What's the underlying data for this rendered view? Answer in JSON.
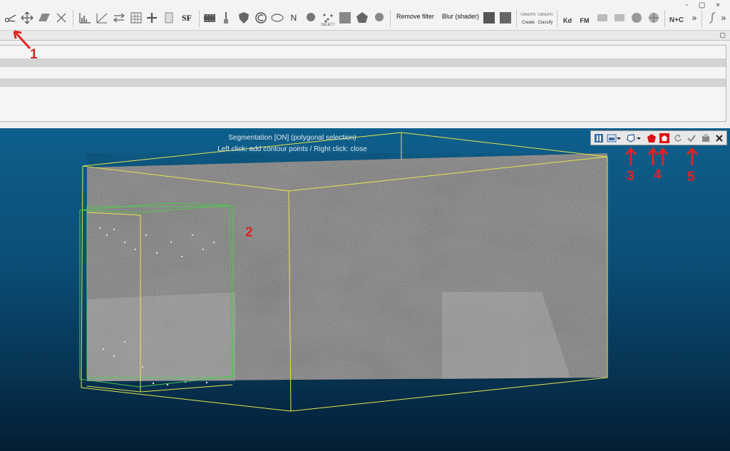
{
  "toolbar": {
    "sf_label": "SF",
    "n_label": "N",
    "select_caption": "SELECT",
    "remove_filter": "Remove filter",
    "blur_shader": "Blur (shader)",
    "canupo_caption1": "CANUPO",
    "create_caption": "Create",
    "canupo_caption2": "CANUPO",
    "classify_caption": "Classify",
    "kd_label": "Kd",
    "fm_label": "FM",
    "nc_label": "N+C",
    "more": "»",
    "more2": "»"
  },
  "window_controls": "- ▢ ×",
  "viewport": {
    "seg_status": "Segmentation [ON] (polygonal selection)",
    "seg_hint": "Left click: add contour points / Right click: close"
  },
  "annotations": [
    "1",
    "2",
    "3",
    "4",
    "5"
  ],
  "colors": {
    "annotation": "#e02323",
    "bbox_outer": "#e6e64a",
    "bbox_inner": "#4fc44f",
    "viewport_top": "#0e5f8c",
    "viewport_bottom": "#041d33"
  },
  "icons": {
    "segment_tool": "scissors-icon",
    "translate_rotate": "move-arrows-icon",
    "pause": "pause-icon",
    "polygon_select": "polygon-icon",
    "inside": "pentagon-filled-icon",
    "outside": "pentagon-outline-icon",
    "reset": "reset-icon",
    "confirm": "checkmark-icon",
    "export": "export-icon",
    "cancel": "close-icon"
  }
}
